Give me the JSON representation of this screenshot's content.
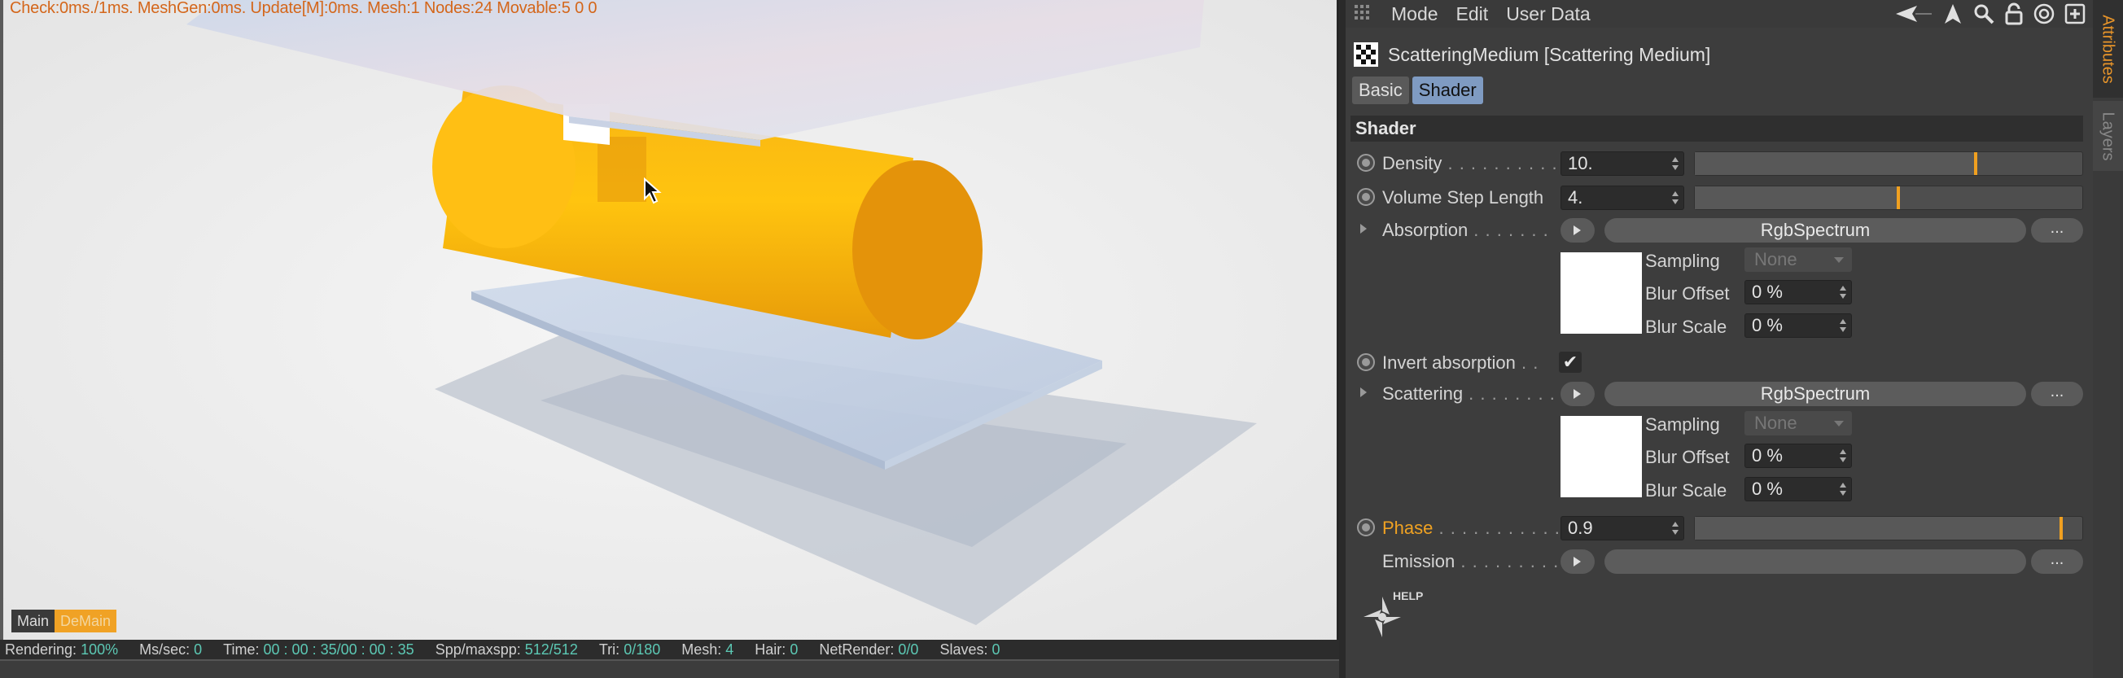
{
  "viewport": {
    "stats_line": "Check:0ms./1ms. MeshGen:0ms. Update[M]:0ms. Mesh:1 Nodes:24 Movable:5  0 0",
    "tab_main": "Main",
    "tab_demain": "DeMain"
  },
  "statusbar": {
    "rendering_label": "Rendering:",
    "rendering_value": "100%",
    "mssec_label": "Ms/sec:",
    "mssec_value": "0",
    "time_label": "Time:",
    "time_value": "00 : 00 : 35/00 : 00 : 35",
    "spp_label": "Spp/maxspp:",
    "spp_value": "512/512",
    "tri_label": "Tri:",
    "tri_value": "0/180",
    "mesh_label": "Mesh:",
    "mesh_value": "4",
    "hair_label": "Hair:",
    "hair_value": "0",
    "netrender_label": "NetRender:",
    "netrender_value": "0/0",
    "slaves_label": "Slaves:",
    "slaves_value": "0"
  },
  "panel": {
    "menu": [
      "Mode",
      "Edit",
      "User Data"
    ],
    "object_title": "ScatteringMedium [Scattering Medium]",
    "tabs": [
      "Basic",
      "Shader"
    ],
    "section_title": "Shader",
    "density": {
      "label": "Density",
      "dots": " . . . . . . . . . .",
      "value": "10.",
      "fraction": 0.73
    },
    "volume_step": {
      "label": "Volume Step Length",
      "value": "4.",
      "fraction": 0.53
    },
    "absorption": {
      "label": "Absorption",
      "dots": " . . . . . . .",
      "button": "RgbSpectrum",
      "more": "..."
    },
    "absorption_sub": {
      "sampling_label": "Sampling",
      "sampling_value": "None",
      "blur_offset_label": "Blur Offset",
      "blur_offset_value": "0 %",
      "blur_scale_label": "Blur Scale",
      "blur_scale_value": "0 %"
    },
    "invert_absorption": {
      "label": "Invert absorption",
      "dots": " . .",
      "check": "✔"
    },
    "scattering": {
      "label": "Scattering",
      "dots": " . . . . . . . .",
      "button": "RgbSpectrum",
      "more": "..."
    },
    "scattering_sub": {
      "sampling_label": "Sampling",
      "sampling_value": "None",
      "blur_offset_label": "Blur Offset",
      "blur_offset_value": "0 %",
      "blur_scale_label": "Blur Scale",
      "blur_scale_value": "0 %"
    },
    "phase": {
      "label": "Phase",
      "dots": " . . . . . . . . . . . .",
      "value": "0.9",
      "fraction": 0.95
    },
    "emission": {
      "label": "Emission",
      "dots": " . . . . . . . . .",
      "button": "",
      "more": "..."
    },
    "help_text": "HELP"
  },
  "sidetabs": {
    "attributes": "Attributes",
    "layers": "Layers"
  },
  "colors": {
    "accent_orange": "#f0a222",
    "stats_orange": "#d4661a",
    "status_teal": "#5cc8b4",
    "tab_active": "#7f9bc2"
  }
}
